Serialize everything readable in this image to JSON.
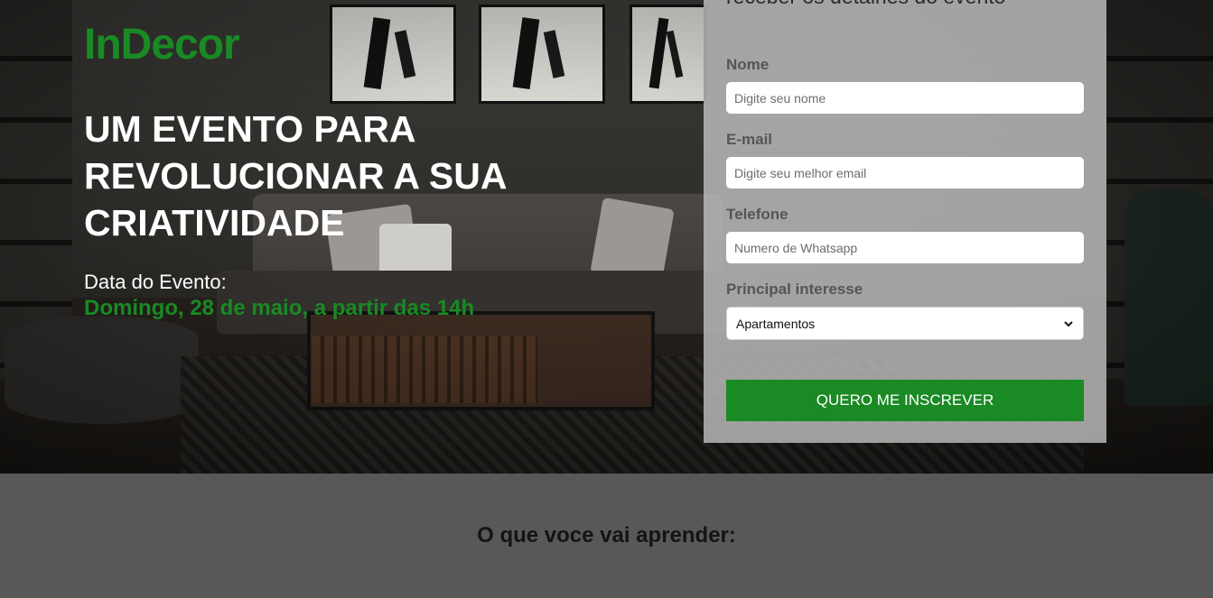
{
  "brand": {
    "logo": "InDecor",
    "accent": "#198a24"
  },
  "hero": {
    "headline": "UM EVENTO PARA REVOLUCIONAR A SUA CRIATIVIDADE",
    "date_label": "Data do Evento:",
    "date_value": "Domingo, 28 de maio, a partir das 14h"
  },
  "form": {
    "title": "receber os detalhes do evento",
    "fields": [
      {
        "label": "Nome",
        "placeholder": "Digite seu nome"
      },
      {
        "label": "E-mail",
        "placeholder": "Digite seu melhor email"
      },
      {
        "label": "Telefone",
        "placeholder": "Numero de Whatsapp"
      }
    ],
    "interest": {
      "label": "Principal interesse",
      "selected": "Apartamentos",
      "icon": "chevron-down-icon"
    },
    "submit_label": "QUERO ME INSCREVER"
  },
  "lower": {
    "title": "O que voce vai aprender:"
  }
}
